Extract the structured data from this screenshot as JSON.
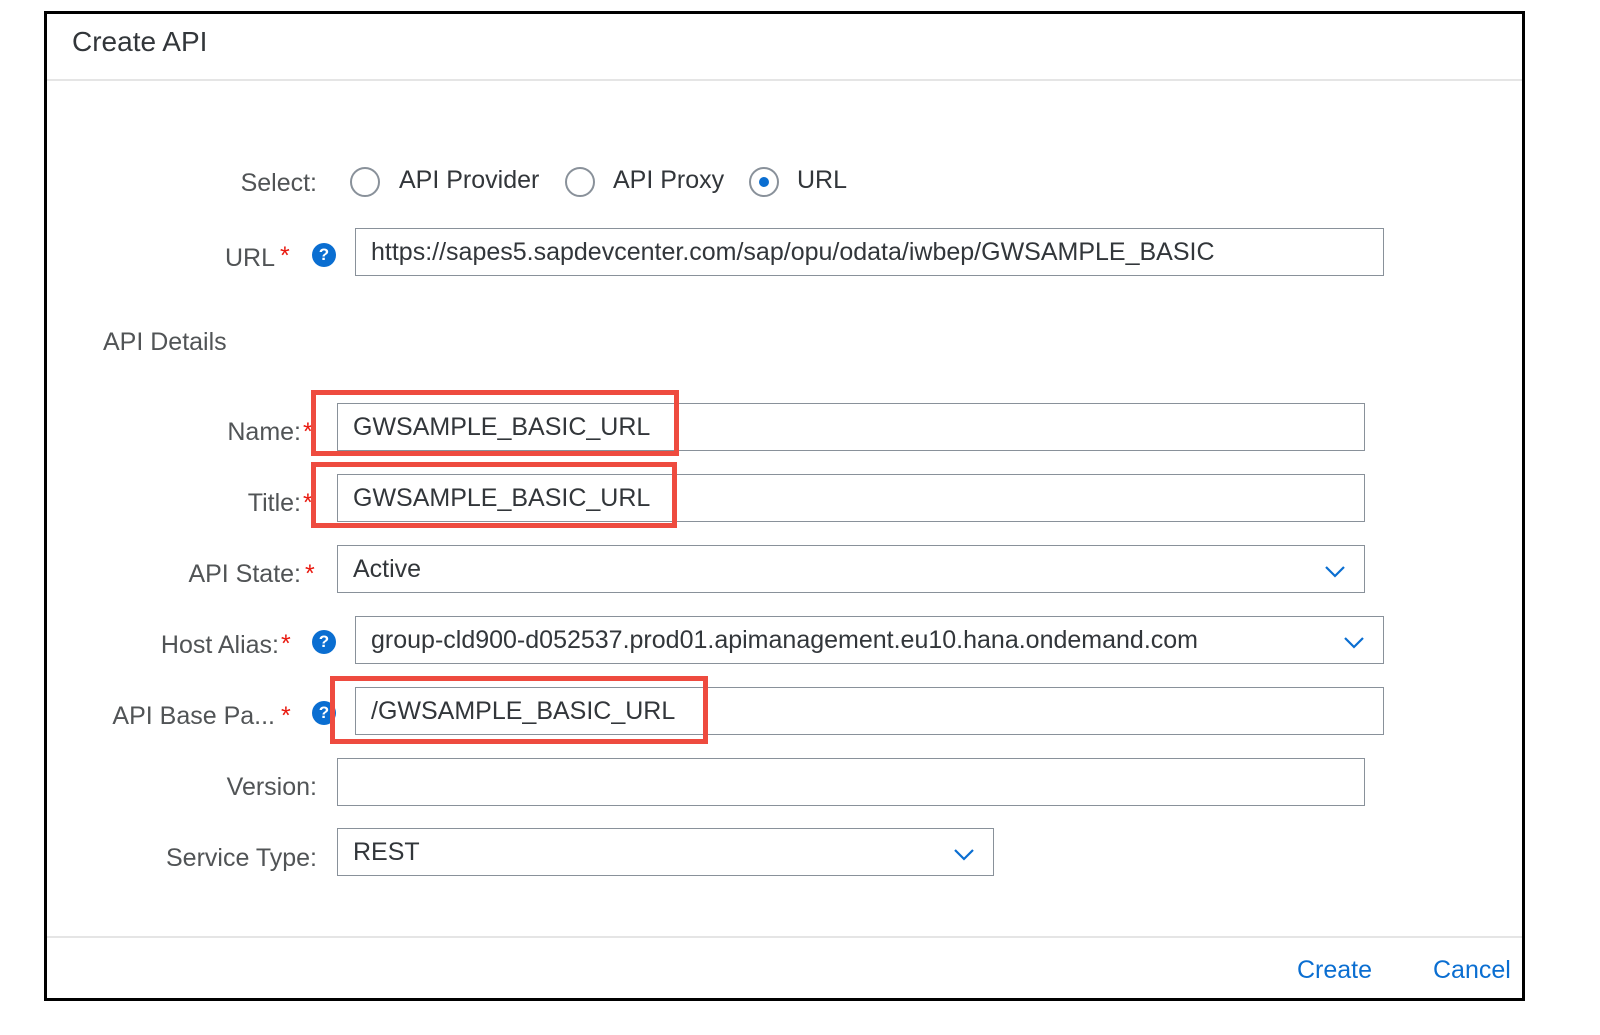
{
  "dialog": {
    "title": "Create API",
    "footer": {
      "create_label": "Create",
      "cancel_label": "Cancel"
    }
  },
  "select": {
    "label": "Select:",
    "options": [
      "API Provider",
      "API Proxy",
      "URL"
    ],
    "selected": "URL"
  },
  "url": {
    "label": "URL",
    "value": "https://sapes5.sapdevcenter.com/sap/opu/odata/iwbep/GWSAMPLE_BASIC"
  },
  "section_title": "API Details",
  "form": {
    "name": {
      "label": "Name:",
      "value": "GWSAMPLE_BASIC_URL"
    },
    "title": {
      "label": "Title:",
      "value": "GWSAMPLE_BASIC_URL"
    },
    "api_state": {
      "label": "API State:",
      "value": "Active"
    },
    "host_alias": {
      "label": "Host Alias:",
      "value": "group-cld900-d052537.prod01.apimanagement.eu10.hana.ondemand.com"
    },
    "base_path": {
      "label": "API Base Pa...",
      "value": "/GWSAMPLE_BASIC_URL"
    },
    "version": {
      "label": "Version:",
      "value": ""
    },
    "service_type": {
      "label": "Service Type:",
      "value": "REST"
    }
  },
  "required_marker": "*",
  "help_glyph": "?",
  "colors": {
    "accent": "#0a6ed1",
    "required": "#e9190f",
    "highlight": "#ee4b3f"
  },
  "icons": [
    "help-icon",
    "chevron-down-icon"
  ]
}
